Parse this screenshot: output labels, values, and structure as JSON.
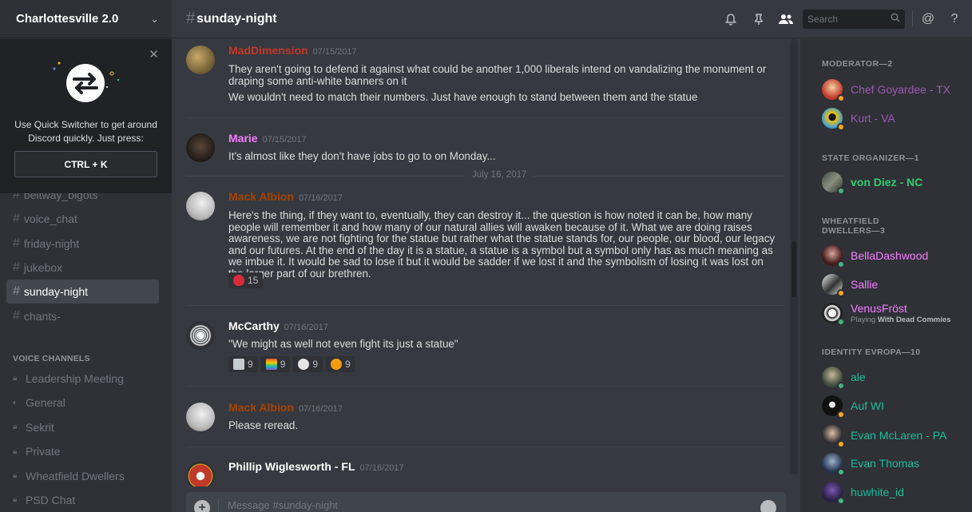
{
  "server": {
    "name": "Charlottesville 2.0"
  },
  "quick_switcher": {
    "text": "Use Quick Switcher to get around Discord quickly. Just press:",
    "shortcut": "CTRL + K"
  },
  "text_channels": [
    {
      "name": "beltway_bigots",
      "active": false
    },
    {
      "name": "voice_chat",
      "active": false
    },
    {
      "name": "friday-night",
      "active": false
    },
    {
      "name": "jukebox",
      "active": false
    },
    {
      "name": "sunday-night",
      "active": true
    },
    {
      "name": "chants-",
      "active": false
    }
  ],
  "voice_header": "VOICE CHANNELS",
  "voice_channels": [
    {
      "name": "Leadership Meeting",
      "icon": "lock-icon"
    },
    {
      "name": "General",
      "icon": "speaker-icon"
    },
    {
      "name": "Sekrit",
      "icon": "lock-icon"
    },
    {
      "name": "Private",
      "icon": "lock-icon"
    },
    {
      "name": "Wheatfield Dwellers",
      "icon": "lock-icon"
    },
    {
      "name": "PSD Chat",
      "icon": "lock-icon"
    }
  ],
  "header": {
    "channel": "sunday-night",
    "search_placeholder": "Search"
  },
  "messages": [
    {
      "author": "MadDimension",
      "color": "#c0392b",
      "timestamp": "07/15/2017",
      "lines": [
        "They aren't going to defend it against what could be another 1,000 liberals intend on vandalizing the monument or draping some anti-white banners on it",
        "We wouldn't need to match their numbers. Just have enough to stand between them and the statue"
      ]
    },
    {
      "author": "Marie",
      "color": "#f47fff",
      "timestamp": "07/15/2017",
      "lines": [
        "It's almost like they don't have jobs to go to on Monday..."
      ]
    },
    {
      "author": "Mack Albion",
      "color": "#a84300",
      "timestamp": "07/16/2017",
      "lines": [
        "Here's the thing, if they want to, eventually, they can destroy it... the question is how noted it can be, how many people will remember it and how many of our natural allies will awaken because of it. What we are doing raises awareness, we are not fighting for the statue but rather what the statue stands for, our people, our blood, our legacy and our futures. At the end of the day it is a statue, a statue is a symbol but a symbol only has as much meaning as we imbue it. It would be sad to lose it but it would be sadder if we lost it and the symbolism of losing it was lost on the larger part of our brethren."
      ],
      "reactions": [
        {
          "emoji": "strawberry",
          "count": "15",
          "color": "#d92b3a"
        }
      ]
    },
    {
      "author": "McCarthy",
      "color": "#ffffff",
      "timestamp": "07/16/2017",
      "lines": [
        "\"We might as well not even fight its just a statue\""
      ],
      "reactions": [
        {
          "emoji": "building",
          "count": "9",
          "color": "#c7ccd1"
        },
        {
          "emoji": "rainbow-flag",
          "count": "9",
          "color": "#e74c3c"
        },
        {
          "emoji": "skull",
          "count": "9",
          "color": "#e6e6e6"
        },
        {
          "emoji": "sparkle",
          "count": "9",
          "color": "#f39c12"
        }
      ]
    },
    {
      "author": "Mack Albion",
      "color": "#a84300",
      "timestamp": "07/16/2017",
      "lines": [
        "Please reread."
      ]
    },
    {
      "author": "Phillip Wiglesworth - FL",
      "color": "#ffffff",
      "timestamp": "07/16/2017",
      "lines": []
    }
  ],
  "date_divider": "July 16, 2017",
  "composer": {
    "placeholder": "Message #sunday-night"
  },
  "roles": [
    {
      "header": "MODERATOR—2",
      "members": [
        {
          "name": "Chef Goyardee - TX",
          "color": "#9b59b6",
          "status": "#faa61a"
        },
        {
          "name": "Kurt - VA",
          "color": "#9b59b6",
          "status": "#faa61a"
        }
      ]
    },
    {
      "header": "STATE ORGANIZER—1",
      "members": [
        {
          "name": "von Diez - NC",
          "color": "#2ecc71",
          "status": "#43b581"
        }
      ]
    },
    {
      "header": "WHEATFIELD DWELLERS—3",
      "members": [
        {
          "name": "BellaDashwood",
          "color": "#f47fff",
          "status": "#43b581"
        },
        {
          "name": "Sallie",
          "color": "#f47fff",
          "status": "#faa61a"
        },
        {
          "name": "VenusFröst",
          "color": "#f47fff",
          "status": "#43b581",
          "activity_prefix": "Playing",
          "activity": "With Dead Commies"
        }
      ]
    },
    {
      "header": "IDENTITY EVROPA—10",
      "members": [
        {
          "name": "ale",
          "color": "#1abc9c",
          "status": "#43b581"
        },
        {
          "name": "Auf WI",
          "color": "#1abc9c",
          "status": "#faa61a"
        },
        {
          "name": "Evan McLaren - PA",
          "color": "#1abc9c",
          "status": "#faa61a"
        },
        {
          "name": "Evan Thomas",
          "color": "#1abc9c",
          "status": "#43b581"
        },
        {
          "name": "huwhite_id",
          "color": "#1abc9c",
          "status": "#43b581"
        }
      ]
    }
  ]
}
